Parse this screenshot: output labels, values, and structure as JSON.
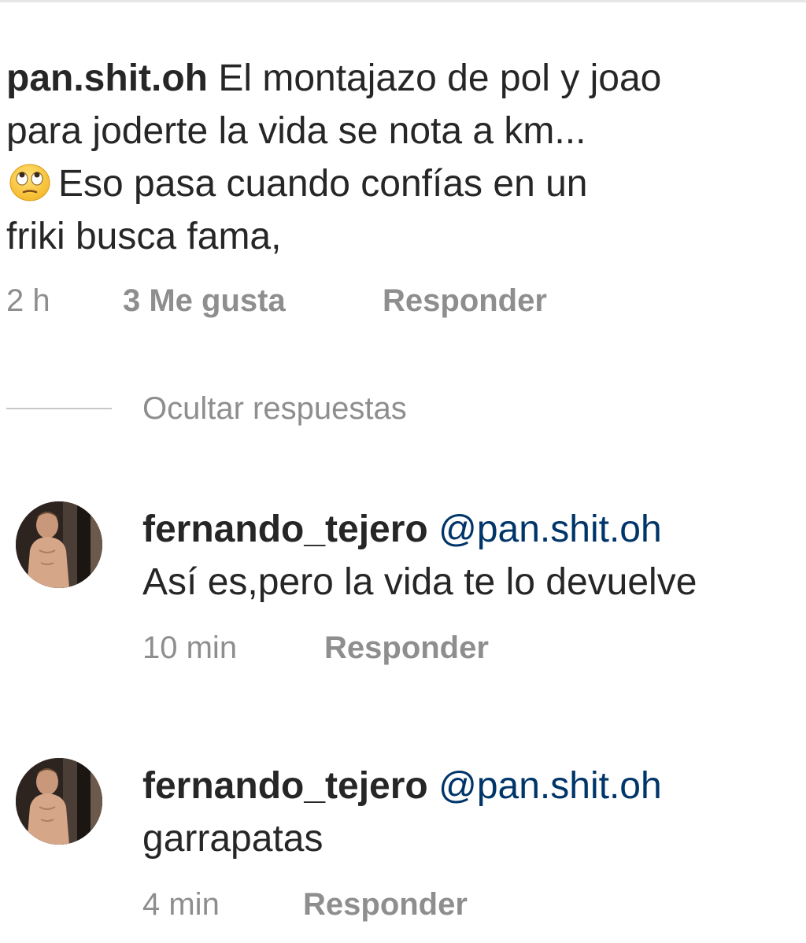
{
  "main_comment": {
    "username": "pan.shit.oh",
    "text_line1": "El montajazo de pol y joao",
    "text_line2": "para joderte la vida se nota a km...",
    "text_line3": "Eso pasa cuando confías en un",
    "text_line4": "friki busca fama,",
    "emoji_icon": "face-with-rolling-eyes-icon",
    "time": "2 h",
    "likes": "3 Me gusta",
    "reply_label": "Responder"
  },
  "replies_toggle": {
    "label": "Ocultar respuestas"
  },
  "replies": [
    {
      "username": "fernando_tejero",
      "mention": "@pan.shit.oh",
      "text": "Así es,pero la vida te lo devuelve",
      "time": "10 min",
      "reply_label": "Responder"
    },
    {
      "username": "fernando_tejero",
      "mention": "@pan.shit.oh",
      "text": "garrapatas",
      "time": "4 min",
      "reply_label": "Responder"
    }
  ],
  "colors": {
    "text": "#262626",
    "secondary": "#8e8e8e",
    "mention": "#003569",
    "divider": "#c7c7c7"
  }
}
